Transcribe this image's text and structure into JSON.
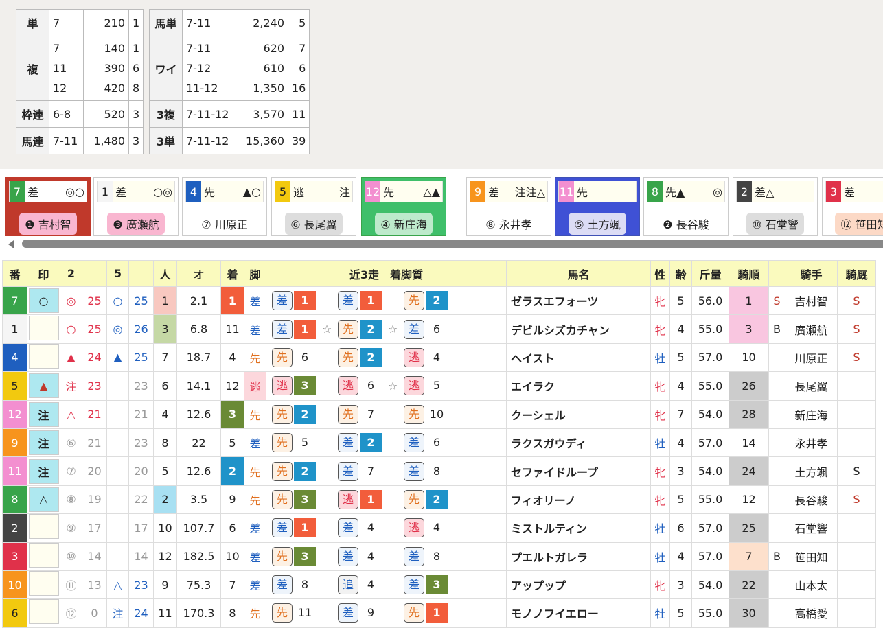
{
  "payout": {
    "left": [
      {
        "type": "単",
        "rows": [
          {
            "n": "7",
            "v": "210",
            "p": "1"
          }
        ]
      },
      {
        "type": "複",
        "rows": [
          {
            "n": "7",
            "v": "140",
            "p": "1"
          },
          {
            "n": "11",
            "v": "390",
            "p": "6"
          },
          {
            "n": "12",
            "v": "420",
            "p": "8"
          }
        ]
      },
      {
        "type": "枠連",
        "rows": [
          {
            "n": "6-8",
            "v": "520",
            "p": "3"
          }
        ]
      },
      {
        "type": "馬連",
        "rows": [
          {
            "n": "7-11",
            "v": "1,480",
            "p": "3"
          }
        ]
      }
    ],
    "right": [
      {
        "type": "馬単",
        "rows": [
          {
            "n": "7-11",
            "v": "2,240",
            "p": "5"
          }
        ]
      },
      {
        "type": "ワイ",
        "rows": [
          {
            "n": "7-11",
            "v": "620",
            "p": "7"
          },
          {
            "n": "7-12",
            "v": "610",
            "p": "6"
          },
          {
            "n": "11-12",
            "v": "1,350",
            "p": "16"
          }
        ]
      },
      {
        "type": "3複",
        "rows": [
          {
            "n": "7-11-12",
            "v": "3,570",
            "p": "11"
          }
        ]
      },
      {
        "type": "3単",
        "rows": [
          {
            "n": "7-11-12",
            "v": "15,360",
            "p": "39"
          }
        ]
      }
    ]
  },
  "colors": {
    "w1": "#f5f5f5",
    "w2": "#222222",
    "w3": "#e0314a",
    "w4": "#1f5fbf",
    "w5": "#f2c90f",
    "w6": "#38a44a",
    "w7": "#f7941d",
    "w8": "#f38fd0",
    "p1": "#f25d3b",
    "p2": "#1f93c9",
    "p3": "#6a8a35",
    "ninki1": "#f8c8c0",
    "ninki2": "#a8e0f2",
    "ninki3": "#c5d8a5"
  },
  "cards": [
    {
      "num": "7",
      "style": "差",
      "marks": "◎○",
      "jockey": "❶ 吉村智",
      "nc": "#38a44a",
      "ntc": "#fff",
      "border": "#c0392b",
      "bg": "#c0392b",
      "jbg": "#f9b6d0",
      "top": "#fff",
      "jcolor": "#222"
    },
    {
      "num": "1",
      "style": "差",
      "marks": "○◎",
      "jockey": "❸ 廣瀬航",
      "nc": "#f5f5f5",
      "ntc": "#222",
      "border": "#ccc",
      "bg": "#fff",
      "jbg": "#f9b6d0",
      "top": "#fffef0",
      "jcolor": "#222"
    },
    {
      "num": "4",
      "style": "先",
      "marks": "▲○",
      "jockey": "⑦ 川原正",
      "nc": "#1f5fbf",
      "ntc": "#fff",
      "border": "#ccc",
      "bg": "#fff",
      "jbg": "transparent",
      "top": "#fffef0",
      "jcolor": "#222"
    },
    {
      "num": "5",
      "style": "逃",
      "marks": "注",
      "jockey": "⑥ 長尾翼",
      "nc": "#f2c90f",
      "ntc": "#222",
      "border": "#ccc",
      "bg": "#fff",
      "jbg": "#dddddd",
      "top": "#fffef0",
      "jcolor": "#222"
    },
    {
      "num": "12",
      "style": "先",
      "marks": "△▲",
      "jockey": "④ 新庄海",
      "nc": "#f38fd0",
      "ntc": "#fff",
      "border": "#38a44a",
      "bg": "#3fbf6a",
      "jbg": "#bdeacb",
      "top": "#fffef0",
      "jcolor": "#222"
    },
    {
      "num": "9",
      "style": "差",
      "marks": "注注△",
      "jockey": "⑧ 永井孝",
      "nc": "#f7941d",
      "ntc": "#fff",
      "border": "#ccc",
      "bg": "#fff",
      "jbg": "transparent",
      "top": "#fffef0",
      "jcolor": "#222"
    },
    {
      "num": "11",
      "style": "先",
      "marks": "",
      "jockey": "⑤ 土方颯",
      "nc": "#f38fd0",
      "ntc": "#fff",
      "border": "#3f51b5",
      "bg": "#3f51d5",
      "jbg": "#dcdcf5",
      "top": "#fffef0",
      "jcolor": "#222"
    },
    {
      "num": "8",
      "style": "先▲",
      "marks": "◎",
      "jockey": "❷ 長谷駿",
      "nc": "#38a44a",
      "ntc": "#fff",
      "border": "#ccc",
      "bg": "#fff",
      "jbg": "transparent",
      "top": "#fffef0",
      "jcolor": "#222"
    },
    {
      "num": "2",
      "style": "差△",
      "marks": "",
      "jockey": "⑩ 石堂響",
      "nc": "#444",
      "ntc": "#fff",
      "border": "#ccc",
      "bg": "#fff",
      "jbg": "#dddddd",
      "top": "#fffef0",
      "jcolor": "#222"
    },
    {
      "num": "3",
      "style": "差",
      "marks": "",
      "jockey": "⑫ 笹田知",
      "nc": "#e0314a",
      "ntc": "#fff",
      "border": "#ccc",
      "bg": "#fff",
      "jbg": "#fcd9c6",
      "top": "#fffef0",
      "jcolor": "#222"
    }
  ],
  "headers": [
    "番",
    "印",
    "2",
    "",
    "5",
    "",
    "人",
    "オ",
    "着",
    "脚",
    "近3走　着脚質",
    "馬名",
    "性",
    "齢",
    "斤量",
    "騎順",
    "",
    "騎手",
    "騎厩"
  ],
  "rows": [
    {
      "num": "7",
      "nc": "#38a44a",
      "ntc": "#fff",
      "mark": "○",
      "mc": "#222",
      "mbg": "#aee8f0",
      "m2": "◎",
      "m2c": "#e0314a",
      "v2": "25",
      "v2c": "#e0314a",
      "m5": "○",
      "m5c": "#1f5fbf",
      "v5": "25",
      "v5c": "#1f5fbf",
      "pop": "1",
      "popbg": "#f8c8c0",
      "odds": "2.1",
      "fin": "1",
      "finbg": "#f25d3b",
      "kya": "差",
      "kyac": "#1f5fbf",
      "kyabg": "",
      "last": [
        [
          "差",
          "1",
          "p1",
          ""
        ],
        [
          "差",
          "1",
          "p1",
          ""
        ],
        [
          "先",
          "2",
          "p2",
          ""
        ]
      ],
      "name": "ゼラスエフォーツ",
      "sex": "牝",
      "sexc": "#e0314a",
      "age": "5",
      "wt": "56.0",
      "jr": "1",
      "jrbg": "#f9c6e0",
      "rk": "S",
      "rkc": "#c0392b",
      "jockey": "吉村智",
      "st": "S",
      "stc": "#c0392b"
    },
    {
      "num": "1",
      "nc": "#f5f5f5",
      "ntc": "#222",
      "mark": "",
      "mc": "#222",
      "mbg": "#fffef0",
      "m2": "○",
      "m2c": "#e0314a",
      "v2": "25",
      "v2c": "#e0314a",
      "m5": "◎",
      "m5c": "#1f5fbf",
      "v5": "26",
      "v5c": "#1f5fbf",
      "pop": "3",
      "popbg": "#c5d8a5",
      "odds": "6.8",
      "fin": "11",
      "finbg": "",
      "kya": "差",
      "kyac": "#1f5fbf",
      "kyabg": "",
      "last": [
        [
          "差",
          "1",
          "p1",
          "☆"
        ],
        [
          "先",
          "2",
          "p2",
          "☆"
        ],
        [
          "差",
          "6",
          "",
          ""
        ]
      ],
      "name": "デビルシズカチャン",
      "sex": "牝",
      "sexc": "#e0314a",
      "age": "4",
      "wt": "55.0",
      "jr": "3",
      "jrbg": "#f9c6e0",
      "rk": "B",
      "rkc": "#222",
      "jockey": "廣瀬航",
      "st": "S",
      "stc": "#c0392b"
    },
    {
      "num": "4",
      "nc": "#1f5fbf",
      "ntc": "#fff",
      "mark": "",
      "mc": "#222",
      "mbg": "#fffef0",
      "m2": "▲",
      "m2c": "#e0314a",
      "v2": "24",
      "v2c": "#e0314a",
      "m5": "▲",
      "m5c": "#1f5fbf",
      "v5": "25",
      "v5c": "#1f5fbf",
      "pop": "7",
      "popbg": "",
      "odds": "18.7",
      "fin": "4",
      "finbg": "",
      "kya": "先",
      "kyac": "#e07020",
      "kyabg": "",
      "last": [
        [
          "先",
          "6",
          "",
          ""
        ],
        [
          "先",
          "2",
          "p2",
          ""
        ],
        [
          "逃",
          "4",
          "",
          ""
        ]
      ],
      "name": "ヘイスト",
      "sex": "牡",
      "sexc": "#1f5fbf",
      "age": "5",
      "wt": "57.0",
      "jr": "10",
      "jrbg": "",
      "rk": "",
      "rkc": "#222",
      "jockey": "川原正",
      "st": "S",
      "stc": "#c0392b"
    },
    {
      "num": "5",
      "nc": "#f2c90f",
      "ntc": "#222",
      "mark": "▲",
      "mc": "#c0392b",
      "mbg": "#aee8f0",
      "m2": "注",
      "m2c": "#e0314a",
      "v2": "23",
      "v2c": "#e0314a",
      "m5": "",
      "m5c": "#1f5fbf",
      "v5": "23",
      "v5c": "#999",
      "pop": "6",
      "popbg": "",
      "odds": "14.1",
      "fin": "12",
      "finbg": "",
      "kya": "逃",
      "kyac": "#e0314a",
      "kyabg": "#fcd7dc",
      "last": [
        [
          "逃",
          "3",
          "p3",
          ""
        ],
        [
          "逃",
          "6",
          "",
          "☆"
        ],
        [
          "逃",
          "5",
          "",
          ""
        ]
      ],
      "name": "エイラク",
      "sex": "牝",
      "sexc": "#e0314a",
      "age": "4",
      "wt": "55.0",
      "jr": "26",
      "jrbg": "#cccccc",
      "rk": "",
      "rkc": "#222",
      "jockey": "長尾翼",
      "st": "",
      "stc": "#c0392b"
    },
    {
      "num": "12",
      "nc": "#f38fd0",
      "ntc": "#fff",
      "mark": "注",
      "mc": "#222",
      "mbg": "#aee8f0",
      "m2": "△",
      "m2c": "#e0314a",
      "v2": "21",
      "v2c": "#e0314a",
      "m5": "",
      "m5c": "#1f5fbf",
      "v5": "21",
      "v5c": "#999",
      "pop": "4",
      "popbg": "",
      "odds": "12.6",
      "fin": "3",
      "finbg": "#6a8a35",
      "kya": "先",
      "kyac": "#e07020",
      "kyabg": "",
      "last": [
        [
          "先",
          "2",
          "p2",
          ""
        ],
        [
          "先",
          "7",
          "",
          ""
        ],
        [
          "先",
          "10",
          "",
          ""
        ]
      ],
      "name": "クーシェル",
      "sex": "牝",
      "sexc": "#e0314a",
      "age": "7",
      "wt": "54.0",
      "jr": "28",
      "jrbg": "#cccccc",
      "rk": "",
      "rkc": "#222",
      "jockey": "新庄海",
      "st": "",
      "stc": "#c0392b"
    },
    {
      "num": "9",
      "nc": "#f7941d",
      "ntc": "#fff",
      "mark": "注",
      "mc": "#222",
      "mbg": "#aee8f0",
      "m2": "⑥",
      "m2c": "#999",
      "v2": "21",
      "v2c": "#999",
      "m5": "",
      "m5c": "#1f5fbf",
      "v5": "23",
      "v5c": "#999",
      "pop": "8",
      "popbg": "",
      "odds": "22",
      "fin": "5",
      "finbg": "",
      "kya": "差",
      "kyac": "#1f5fbf",
      "kyabg": "",
      "last": [
        [
          "先",
          "5",
          "",
          ""
        ],
        [
          "差",
          "2",
          "p2",
          ""
        ],
        [
          "差",
          "6",
          "",
          ""
        ]
      ],
      "name": "ラクスガウディ",
      "sex": "牡",
      "sexc": "#1f5fbf",
      "age": "4",
      "wt": "57.0",
      "jr": "14",
      "jrbg": "",
      "rk": "",
      "rkc": "#222",
      "jockey": "永井孝",
      "st": "",
      "stc": "#c0392b"
    },
    {
      "num": "11",
      "nc": "#f38fd0",
      "ntc": "#fff",
      "mark": "注",
      "mc": "#222",
      "mbg": "#aee8f0",
      "m2": "⑦",
      "m2c": "#999",
      "v2": "20",
      "v2c": "#999",
      "m5": "",
      "m5c": "#1f5fbf",
      "v5": "20",
      "v5c": "#999",
      "pop": "5",
      "popbg": "",
      "odds": "12.6",
      "fin": "2",
      "finbg": "#1f93c9",
      "kya": "先",
      "kyac": "#e07020",
      "kyabg": "",
      "last": [
        [
          "先",
          "2",
          "p2",
          ""
        ],
        [
          "差",
          "7",
          "",
          ""
        ],
        [
          "差",
          "8",
          "",
          ""
        ]
      ],
      "name": "セファイドループ",
      "sex": "牝",
      "sexc": "#e0314a",
      "age": "3",
      "wt": "54.0",
      "jr": "24",
      "jrbg": "#cccccc",
      "rk": "",
      "rkc": "#222",
      "jockey": "土方颯",
      "st": "S",
      "stc": "#222"
    },
    {
      "num": "8",
      "nc": "#38a44a",
      "ntc": "#fff",
      "mark": "△",
      "mc": "#222",
      "mbg": "#aee8f0",
      "m2": "⑧",
      "m2c": "#999",
      "v2": "19",
      "v2c": "#999",
      "m5": "",
      "m5c": "#1f5fbf",
      "v5": "22",
      "v5c": "#999",
      "pop": "2",
      "popbg": "#a8e0f2",
      "odds": "3.5",
      "fin": "9",
      "finbg": "",
      "kya": "先",
      "kyac": "#e07020",
      "kyabg": "",
      "last": [
        [
          "先",
          "3",
          "p3",
          ""
        ],
        [
          "逃",
          "1",
          "p1",
          ""
        ],
        [
          "先",
          "2",
          "p2",
          ""
        ]
      ],
      "name": "フィオリーノ",
      "sex": "牝",
      "sexc": "#e0314a",
      "age": "5",
      "wt": "55.0",
      "jr": "12",
      "jrbg": "",
      "rk": "",
      "rkc": "#222",
      "jockey": "長谷駿",
      "st": "S",
      "stc": "#c0392b"
    },
    {
      "num": "2",
      "nc": "#444",
      "ntc": "#fff",
      "mark": "",
      "mc": "#222",
      "mbg": "#fffef0",
      "m2": "⑨",
      "m2c": "#999",
      "v2": "17",
      "v2c": "#999",
      "m5": "",
      "m5c": "#1f5fbf",
      "v5": "17",
      "v5c": "#999",
      "pop": "10",
      "popbg": "",
      "odds": "107.7",
      "fin": "6",
      "finbg": "",
      "kya": "差",
      "kyac": "#1f5fbf",
      "kyabg": "",
      "last": [
        [
          "差",
          "1",
          "p1",
          ""
        ],
        [
          "差",
          "4",
          "",
          ""
        ],
        [
          "逃",
          "4",
          "",
          ""
        ]
      ],
      "name": "ミストルティン",
      "sex": "牡",
      "sexc": "#1f5fbf",
      "age": "6",
      "wt": "57.0",
      "jr": "25",
      "jrbg": "#cccccc",
      "rk": "",
      "rkc": "#222",
      "jockey": "石堂響",
      "st": "",
      "stc": "#c0392b"
    },
    {
      "num": "3",
      "nc": "#e0314a",
      "ntc": "#fff",
      "mark": "",
      "mc": "#222",
      "mbg": "#fffef0",
      "m2": "⑩",
      "m2c": "#999",
      "v2": "14",
      "v2c": "#999",
      "m5": "",
      "m5c": "#1f5fbf",
      "v5": "14",
      "v5c": "#999",
      "pop": "12",
      "popbg": "",
      "odds": "182.5",
      "fin": "10",
      "finbg": "",
      "kya": "差",
      "kyac": "#1f5fbf",
      "kyabg": "",
      "last": [
        [
          "先",
          "3",
          "p3",
          ""
        ],
        [
          "差",
          "4",
          "",
          ""
        ],
        [
          "差",
          "8",
          "",
          ""
        ]
      ],
      "name": "プエルトガレラ",
      "sex": "牡",
      "sexc": "#1f5fbf",
      "age": "4",
      "wt": "57.0",
      "jr": "7",
      "jrbg": "#fde0cc",
      "rk": "B",
      "rkc": "#222",
      "jockey": "笹田知",
      "st": "",
      "stc": "#c0392b"
    },
    {
      "num": "10",
      "nc": "#f7941d",
      "ntc": "#fff",
      "mark": "",
      "mc": "#222",
      "mbg": "#fffef0",
      "m2": "⑪",
      "m2c": "#999",
      "v2": "13",
      "v2c": "#999",
      "m5": "△",
      "m5c": "#1f5fbf",
      "v5": "23",
      "v5c": "#1f5fbf",
      "pop": "9",
      "popbg": "",
      "odds": "75.3",
      "fin": "7",
      "finbg": "",
      "kya": "差",
      "kyac": "#1f5fbf",
      "kyabg": "",
      "last": [
        [
          "差",
          "8",
          "",
          ""
        ],
        [
          "追",
          "4",
          "",
          ""
        ],
        [
          "差",
          "3",
          "p3",
          ""
        ]
      ],
      "name": "アップップ",
      "sex": "牝",
      "sexc": "#e0314a",
      "age": "3",
      "wt": "54.0",
      "jr": "22",
      "jrbg": "#cccccc",
      "rk": "",
      "rkc": "#222",
      "jockey": "山本太",
      "st": "",
      "stc": "#c0392b"
    },
    {
      "num": "6",
      "nc": "#f2c90f",
      "ntc": "#222",
      "mark": "",
      "mc": "#222",
      "mbg": "#fffef0",
      "m2": "⑫",
      "m2c": "#999",
      "v2": "0",
      "v2c": "#999",
      "m5": "注",
      "m5c": "#1f5fbf",
      "v5": "24",
      "v5c": "#1f5fbf",
      "pop": "11",
      "popbg": "",
      "odds": "170.3",
      "fin": "8",
      "finbg": "",
      "kya": "先",
      "kyac": "#e07020",
      "kyabg": "",
      "last": [
        [
          "先",
          "11",
          "",
          ""
        ],
        [
          "差",
          "9",
          "",
          ""
        ],
        [
          "先",
          "1",
          "p1",
          ""
        ]
      ],
      "name": "モノノフイエロー",
      "sex": "牡",
      "sexc": "#1f5fbf",
      "age": "5",
      "wt": "55.0",
      "jr": "30",
      "jrbg": "#cccccc",
      "rk": "",
      "rkc": "#222",
      "jockey": "高橋愛",
      "st": "",
      "stc": "#c0392b"
    }
  ]
}
